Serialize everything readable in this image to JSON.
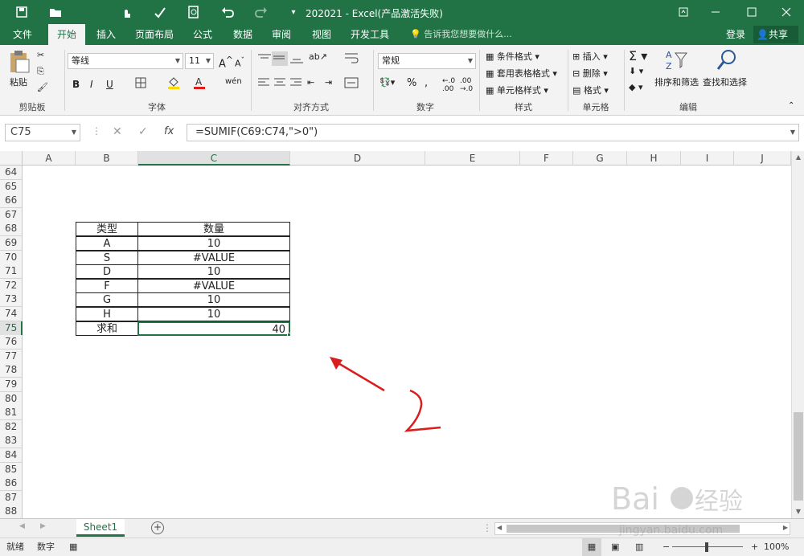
{
  "title": "202021 - Excel(产品激活失败)",
  "tabs": [
    "文件",
    "开始",
    "插入",
    "页面布局",
    "公式",
    "数据",
    "审阅",
    "视图",
    "开发工具"
  ],
  "active_tab": "开始",
  "tell_me": "告诉我您想要做什么...",
  "login": "登录",
  "share": "共享",
  "ribbon": {
    "clipboard": {
      "paste": "粘贴",
      "label": "剪贴板"
    },
    "font": {
      "name": "等线",
      "size": "11",
      "label": "字体"
    },
    "alignment": {
      "label": "对齐方式"
    },
    "number": {
      "format": "常规",
      "label": "数字"
    },
    "styles": {
      "conditional": "条件格式",
      "table": "套用表格格式",
      "cell": "单元格样式",
      "label": "样式"
    },
    "cells": {
      "insert": "插入",
      "delete": "删除",
      "format": "格式",
      "label": "单元格"
    },
    "editing": {
      "sort": "排序和筛选",
      "find": "查找和选择",
      "label": "编辑"
    }
  },
  "name_box": "C75",
  "formula": "=SUMIF(C69:C74,\">0\")",
  "columns": [
    "A",
    "B",
    "C",
    "D",
    "E",
    "F",
    "G",
    "H",
    "I",
    "J"
  ],
  "rows": [
    "64",
    "65",
    "66",
    "67",
    "68",
    "69",
    "70",
    "71",
    "72",
    "73",
    "74",
    "75",
    "76",
    "77",
    "78",
    "79",
    "80",
    "81",
    "82",
    "83",
    "84",
    "85",
    "86",
    "87",
    "88"
  ],
  "table": {
    "header": [
      "类型",
      "数量"
    ],
    "rows": [
      [
        "A",
        "10"
      ],
      [
        "S",
        "#VALUE"
      ],
      [
        "D",
        "10"
      ],
      [
        "F",
        "#VALUE"
      ],
      [
        "G",
        "10"
      ],
      [
        "H",
        "10"
      ]
    ],
    "total": [
      "求和",
      "40"
    ]
  },
  "sheet_tab": "Sheet1",
  "status": {
    "ready": "就绪",
    "mode": "数字",
    "zoom": "100%"
  },
  "colors": {
    "accent": "#217346",
    "arrow": "#d81e1e"
  },
  "watermark": "Baidu经验 jingyan.baidu.com"
}
